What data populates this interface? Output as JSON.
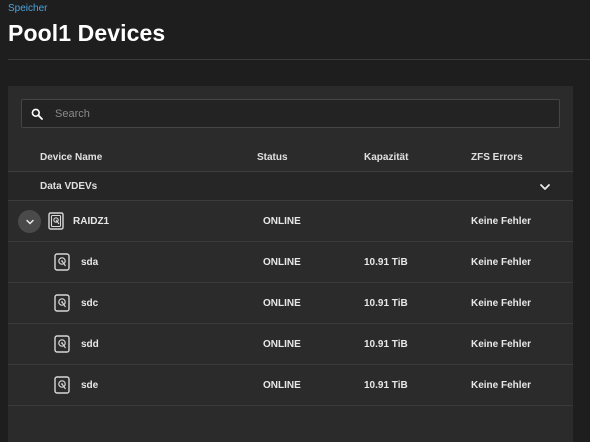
{
  "breadcrumb": "Speicher",
  "page_title": "Pool1 Devices",
  "search": {
    "placeholder": "Search"
  },
  "columns": {
    "device_name": "Device Name",
    "status": "Status",
    "capacity": "Kapazität",
    "errors": "ZFS Errors"
  },
  "group": {
    "label": "Data VDEVs"
  },
  "vdev": {
    "name": "RAIDZ1",
    "status": "ONLINE",
    "capacity": "",
    "errors": "Keine Fehler"
  },
  "disks": [
    {
      "name": "sda",
      "status": "ONLINE",
      "capacity": "10.91 TiB",
      "errors": "Keine Fehler"
    },
    {
      "name": "sdc",
      "status": "ONLINE",
      "capacity": "10.91 TiB",
      "errors": "Keine Fehler"
    },
    {
      "name": "sdd",
      "status": "ONLINE",
      "capacity": "10.91 TiB",
      "errors": "Keine Fehler"
    },
    {
      "name": "sde",
      "status": "ONLINE",
      "capacity": "10.91 TiB",
      "errors": "Keine Fehler"
    }
  ],
  "icons": {
    "search": "search-icon",
    "chevron": "chevron-down-icon",
    "vdev": "vdev-icon",
    "disk": "disk-icon"
  }
}
